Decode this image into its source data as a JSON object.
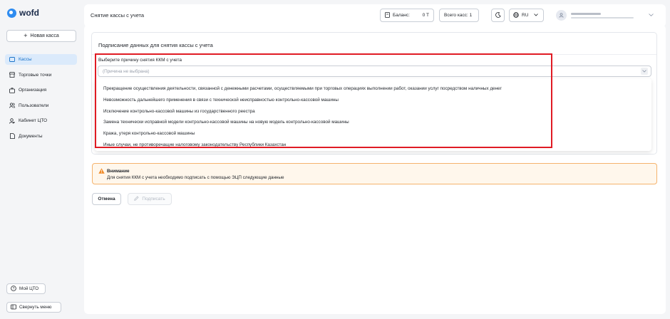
{
  "app": {
    "logo_text": "wofd"
  },
  "sidebar": {
    "new_kassa_label": "Новая касса",
    "items": [
      {
        "label": "Кассы",
        "icon": "cash-register-icon"
      },
      {
        "label": "Торговые точки",
        "icon": "store-icon"
      },
      {
        "label": "Организация",
        "icon": "briefcase-icon"
      },
      {
        "label": "Пользователи",
        "icon": "users-icon"
      },
      {
        "label": "Кабинет ЦТО",
        "icon": "user-cabinet-icon"
      },
      {
        "label": "Документы",
        "icon": "document-icon"
      }
    ],
    "help_label": "Мой ЦТО",
    "collapse_label": "Свернуть меню"
  },
  "header": {
    "title": "Снятие кассы с учета",
    "balance_label": "Баланс:",
    "balance_value": "0 Т",
    "count_label": "Всего касс: 1",
    "lang": "RU"
  },
  "form": {
    "card_title": "Подписание данных для снятия кассы с учета",
    "field_label": "Выберите причину снятия ККМ с учета",
    "select_placeholder": "(Причина не выбрана)",
    "options": [
      "Прекращение осуществления деятельности, связанной с денежными расчетами, осуществляемыми при торговых операциях выполнении работ, оказании услуг посредством наличных денег",
      "Невозможность дальнейшего применения в связи с технической неисправностью контрольно-кассовой машины",
      "Исключение контрольно-кассовой машины из государственного реестра",
      "Замена технически исправной модели контрольно-кассовой машины на новую модель контрольно-кассовой машины",
      "Кража, утеря контрольно-кассовой машины",
      "Иные случаи, не противоречащие налоговому законодательству Республики Казахстан"
    ]
  },
  "warning": {
    "title": "Внимание",
    "text": "Для снятия ККМ с учета необходимо подписать с помощью ЭЦП следующие данные"
  },
  "actions": {
    "cancel_label": "Отмена",
    "sign_label": "Подписать"
  },
  "colors": {
    "accent": "#2f8cf0",
    "highlight": "#e01b24",
    "warning_border": "#f5b36d",
    "warning_bg": "#fff7ec"
  }
}
